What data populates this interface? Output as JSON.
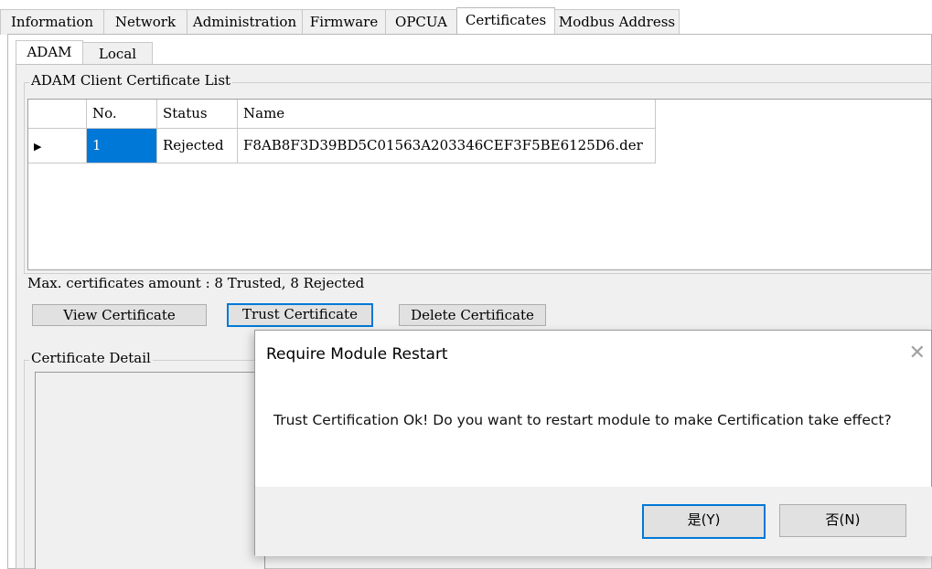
{
  "top_tabs": [
    "Information",
    "Network",
    "Administration",
    "Firmware",
    "OPCUA",
    "Certificates",
    "Modbus Address"
  ],
  "sub_tabs": [
    "ADAM",
    "Local"
  ],
  "cert_list": {
    "legend": "ADAM Client Certificate List",
    "columns": [
      "No.",
      "Status",
      "Name"
    ],
    "rows": [
      {
        "no": "1",
        "status": "Rejected",
        "name": "F8AB8F3D39BD5C01563A203346CEF3F5BE6125D6.der"
      }
    ]
  },
  "max_amount": "Max. certificates amount : 8 Trusted, 8 Rejected",
  "buttons": {
    "view": "View Certificate",
    "trust": "Trust Certificate",
    "delete": "Delete Certificate"
  },
  "detail_legend": "Certificate Detail",
  "dialog": {
    "title": "Require Module Restart",
    "close_glyph": "✕",
    "message": "Trust Certification Ok! Do you want to restart module to make Certification take effect?",
    "yes_label": "是(Y)",
    "no_label": "否(N)"
  },
  "colors": {
    "selection": "#0078d7",
    "panel_bg": "#f0f0f0"
  }
}
